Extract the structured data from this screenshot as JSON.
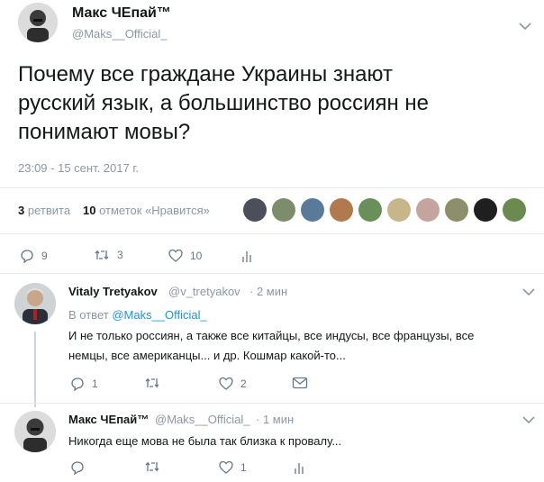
{
  "main_tweet": {
    "author_name": "Макс ЧЕпай™",
    "author_handle": "@Maks__Official_",
    "text_line1": "Почему все граждане Украины знают",
    "text_line2": "русский язык, а большинство россиян не",
    "text_line3": "понимают мовы?",
    "timestamp": "23:09 - 15 сент. 2017 г.",
    "retweets_count": "3",
    "retweets_label": "ретвита",
    "likes_count": "10",
    "likes_label": "отметок «Нравится»",
    "actions": {
      "reply": "9",
      "retweet": "3",
      "like": "10"
    }
  },
  "replies": [
    {
      "author_name": "Vitaly Tretyakov",
      "author_handle": "@v_tretyakov",
      "time": "· 2 мин",
      "in_reply_prefix": "В ответ",
      "in_reply_handle": "@Maks__Official_",
      "text_line1": "И не только россиян, а также все китайцы, все индусы, все французы, все",
      "text_line2": "немцы, все американцы... и др. Кошмар какой-то...",
      "actions": {
        "reply": "1",
        "retweet": "",
        "like": "2"
      }
    },
    {
      "author_name": "Макс ЧЕпай™",
      "author_handle": "@Maks__Official_",
      "time": "· 1 мин",
      "text_line1": "Никогда еще мова не была так близка к провалу...",
      "actions": {
        "reply": "",
        "retweet": "",
        "like": "1"
      }
    }
  ],
  "icons": [
    "chevron-down-icon",
    "reply-icon",
    "retweet-icon",
    "like-icon",
    "analytics-icon",
    "message-icon"
  ],
  "colors": {
    "text": "#14171a",
    "muted": "#8b98a5",
    "link": "#1b95e0",
    "divider": "#e6ecf0"
  }
}
